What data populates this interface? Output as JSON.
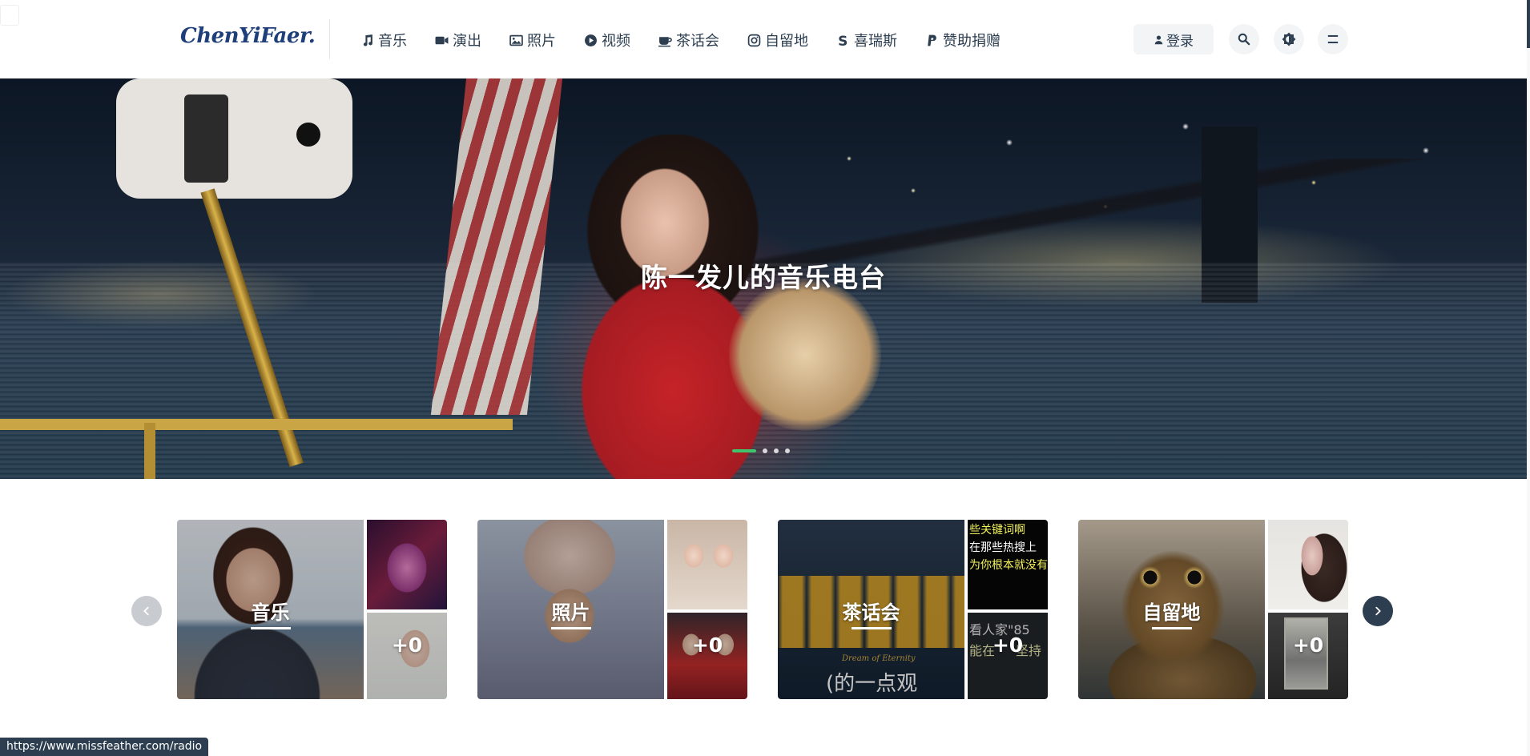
{
  "header": {
    "logo": "ChenYiFaer.",
    "nav": [
      {
        "label": "音乐",
        "icon": "music-note-icon"
      },
      {
        "label": "演出",
        "icon": "video-camera-icon"
      },
      {
        "label": "照片",
        "icon": "image-icon"
      },
      {
        "label": "视频",
        "icon": "play-circle-icon"
      },
      {
        "label": "茶话会",
        "icon": "coffee-cup-icon"
      },
      {
        "label": "自留地",
        "icon": "instagram-icon"
      },
      {
        "label": "喜瑞斯",
        "icon": "s-letter-icon"
      },
      {
        "label": "赞助捐赠",
        "icon": "paypal-icon"
      }
    ],
    "login_label": "登录"
  },
  "hero": {
    "title": "陈一发儿的音乐电台",
    "slide_count": 4,
    "active_slide": 1
  },
  "categories": [
    {
      "label": "音乐",
      "more": "+0"
    },
    {
      "label": "照片",
      "more": "+0"
    },
    {
      "label": "茶话会",
      "more": "+0"
    },
    {
      "label": "自留地",
      "more": "+0"
    }
  ],
  "tea_party_overlay": {
    "top_lines": [
      "些关键词啊",
      "在那些热搜上",
      "为你根本就没有"
    ],
    "bottom_lines": [
      "看人家\"85",
      "能在",
      "坚持"
    ],
    "poster_text": "(的一点观",
    "poster_caption": "Dream of Eternity"
  },
  "status_bar": {
    "url": "https://www.missfeather.com/radio"
  },
  "colors": {
    "brand": "#1f3f7a",
    "nav_text": "#2c3e50",
    "accent_green": "#3ec46d",
    "dark_button": "#2c3e50"
  }
}
